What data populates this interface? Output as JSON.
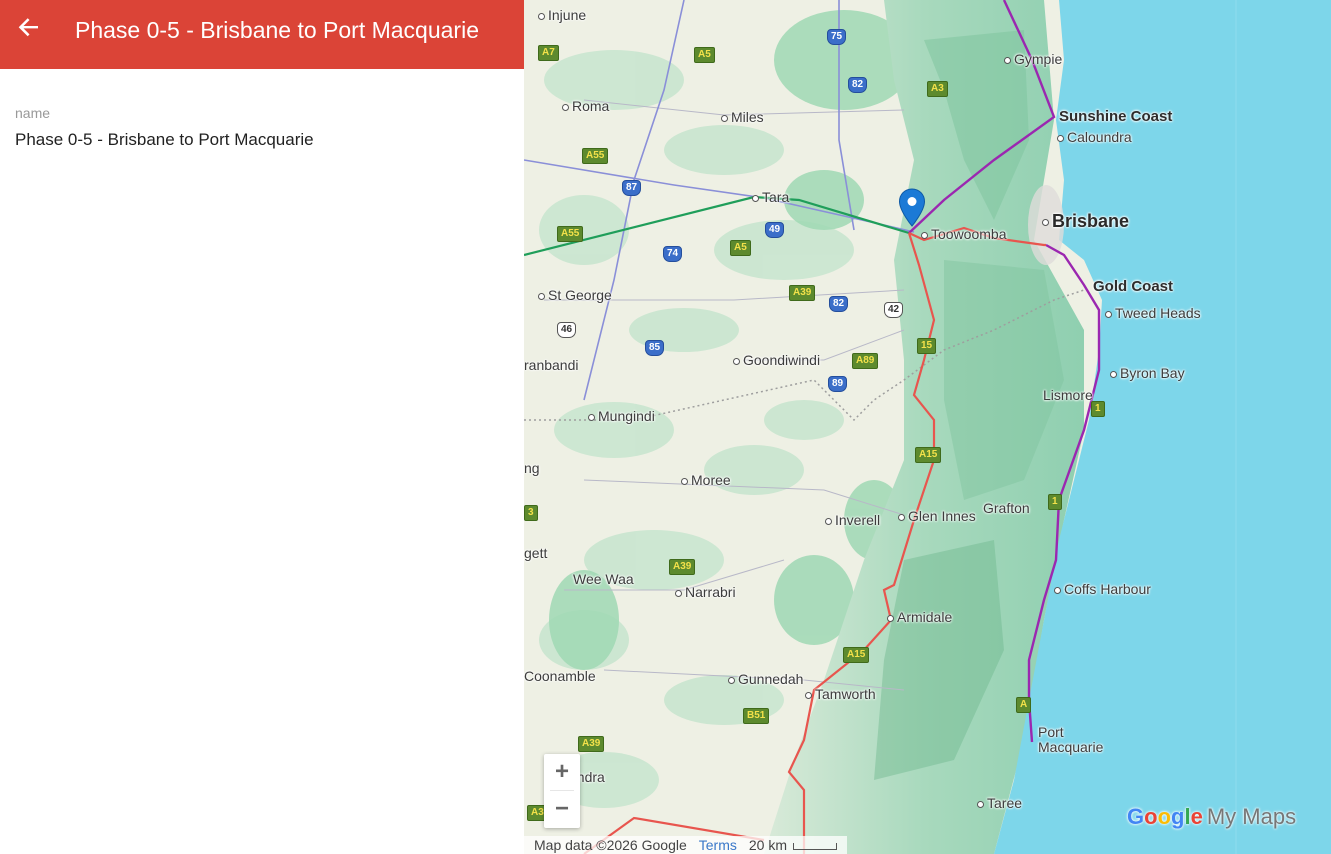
{
  "header": {
    "title": "Phase 0-5 - Brisbane to Port Macquarie"
  },
  "details": {
    "field_label": "name",
    "field_value": "Phase 0-5 - Brisbane to Port Macquarie"
  },
  "map": {
    "towns": [
      {
        "name": "Injune",
        "style": "normal",
        "dot": true
      },
      {
        "name": "Roma",
        "style": "normal",
        "dot": true
      },
      {
        "name": "Miles",
        "style": "normal",
        "dot": true
      },
      {
        "name": "Gympie",
        "style": "normal",
        "dot": true
      },
      {
        "name": "Sunshine Coast",
        "style": "big",
        "dot": false
      },
      {
        "name": "Caloundra",
        "style": "normal",
        "dot": true
      },
      {
        "name": "Tara",
        "style": "normal",
        "dot": true
      },
      {
        "name": "Toowoomba",
        "style": "normal",
        "dot": true
      },
      {
        "name": "Brisbane",
        "style": "huge",
        "dot": true
      },
      {
        "name": "Gold Coast",
        "style": "big",
        "dot": false
      },
      {
        "name": "Tweed Heads",
        "style": "normal",
        "dot": true
      },
      {
        "name": "St George",
        "style": "normal",
        "dot": true
      },
      {
        "name": "Goondiwindi",
        "style": "normal",
        "dot": true
      },
      {
        "name": "ranbandi",
        "style": "normal",
        "dot": false
      },
      {
        "name": "Byron Bay",
        "style": "normal",
        "dot": true
      },
      {
        "name": "Lismore",
        "style": "normal",
        "dot": false
      },
      {
        "name": "Mungindi",
        "style": "normal",
        "dot": true
      },
      {
        "name": "Moree",
        "style": "normal",
        "dot": true
      },
      {
        "name": "ng",
        "style": "normal",
        "dot": false
      },
      {
        "name": "Inverell",
        "style": "normal",
        "dot": true
      },
      {
        "name": "Glen Innes",
        "style": "normal",
        "dot": true
      },
      {
        "name": "Grafton",
        "style": "normal",
        "dot": false
      },
      {
        "name": "gett",
        "style": "normal",
        "dot": false
      },
      {
        "name": "Wee Waa",
        "style": "normal",
        "dot": false
      },
      {
        "name": "Narrabri",
        "style": "normal",
        "dot": true
      },
      {
        "name": "Coffs Harbour",
        "style": "normal",
        "dot": true
      },
      {
        "name": "Armidale",
        "style": "normal",
        "dot": true
      },
      {
        "name": "Coonamble",
        "style": "normal",
        "dot": false
      },
      {
        "name": "Gunnedah",
        "style": "normal",
        "dot": true
      },
      {
        "name": "Tamworth",
        "style": "normal",
        "dot": true
      },
      {
        "name": "Port",
        "style": "normal",
        "dot": false
      },
      {
        "name": "Macquarie",
        "style": "normal",
        "dot": false
      },
      {
        "name": "andra",
        "style": "normal",
        "dot": false
      },
      {
        "name": "Taree",
        "style": "normal",
        "dot": true
      }
    ],
    "shields": [
      {
        "label": "A7",
        "type": "green"
      },
      {
        "label": "A5",
        "type": "green"
      },
      {
        "label": "75",
        "type": "blue"
      },
      {
        "label": "82",
        "type": "blue"
      },
      {
        "label": "A3",
        "type": "green"
      },
      {
        "label": "A55",
        "type": "green"
      },
      {
        "label": "87",
        "type": "blue"
      },
      {
        "label": "49",
        "type": "blue"
      },
      {
        "label": "A55",
        "type": "green"
      },
      {
        "label": "74",
        "type": "blue"
      },
      {
        "label": "A5",
        "type": "green"
      },
      {
        "label": "A39",
        "type": "green"
      },
      {
        "label": "82",
        "type": "blue"
      },
      {
        "label": "42",
        "type": "white"
      },
      {
        "label": "46",
        "type": "white"
      },
      {
        "label": "85",
        "type": "blue"
      },
      {
        "label": "A89",
        "type": "green"
      },
      {
        "label": "15",
        "type": "green"
      },
      {
        "label": "89",
        "type": "blue"
      },
      {
        "label": "A15",
        "type": "green"
      },
      {
        "label": "A39",
        "type": "green"
      },
      {
        "label": "A15",
        "type": "green"
      },
      {
        "label": "B51",
        "type": "green"
      },
      {
        "label": "A39",
        "type": "green"
      },
      {
        "label": "A3",
        "type": "green"
      },
      {
        "label": "1",
        "type": "green"
      },
      {
        "label": "1",
        "type": "green"
      },
      {
        "label": "A",
        "type": "green"
      },
      {
        "label": "3",
        "type": "green"
      }
    ],
    "zoom_in_label": "+",
    "zoom_out_label": "−",
    "attribution": "Map data ©2026 Google",
    "terms_label": "Terms",
    "scale_label": "20 km",
    "logo_brand": [
      "G",
      "o",
      "o",
      "g",
      "l",
      "e"
    ],
    "logo_product": "My Maps",
    "colors": {
      "header": "#db4437",
      "route_red": "#e8554e",
      "route_purple": "#9b27b0",
      "route_green": "#1f9e5a",
      "route_blue": "#8a8fd8",
      "water": "#7dd6ea",
      "pin": "#1b7ad6"
    }
  }
}
